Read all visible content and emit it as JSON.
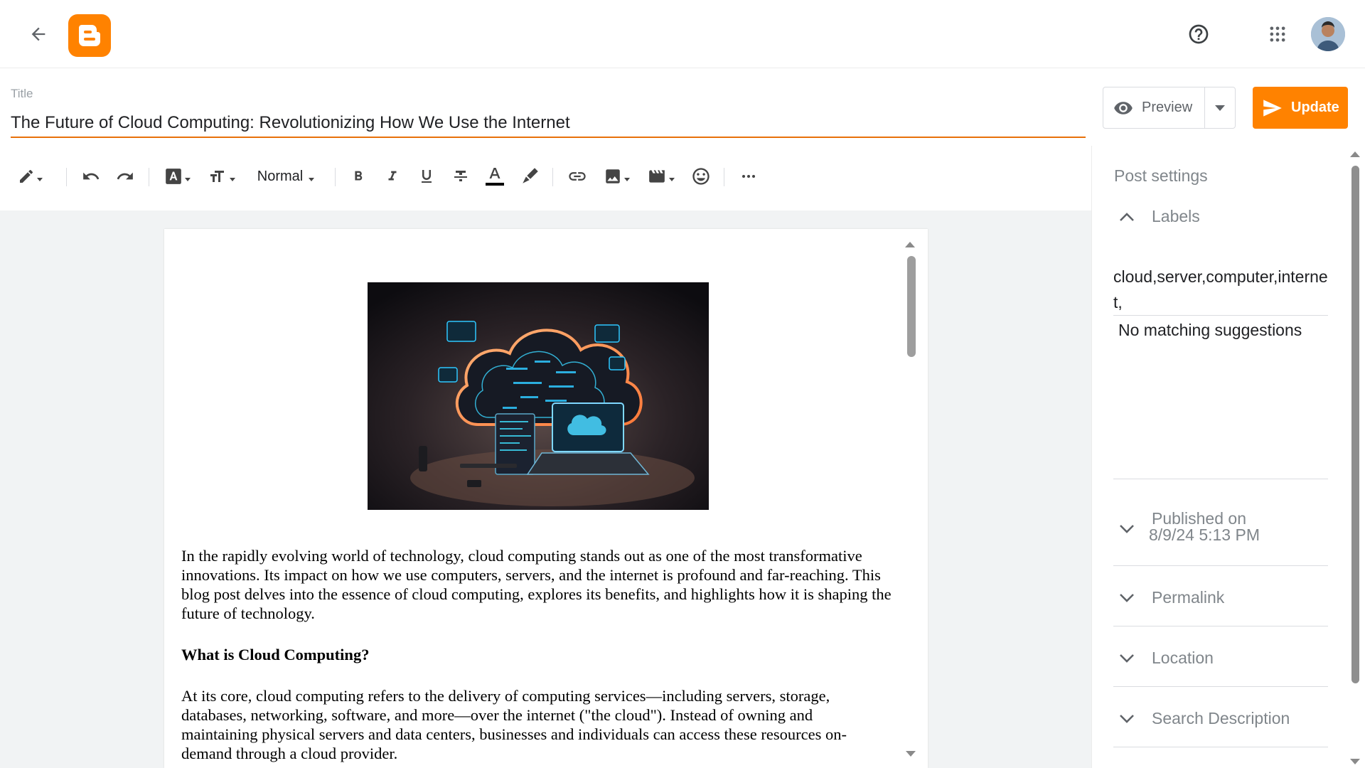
{
  "title_field": {
    "label": "Title",
    "value": "The Future of Cloud Computing: Revolutionizing How We Use the Internet"
  },
  "actions": {
    "preview_label": "Preview",
    "update_label": "Update"
  },
  "toolbar": {
    "paragraph_style": "Normal",
    "icons": [
      "pencil-icon",
      "undo-icon",
      "redo-icon",
      "font-icon",
      "text-size-icon",
      "bold-icon",
      "italic-icon",
      "underline-icon",
      "strikethrough-icon",
      "text-color-icon",
      "highlight-icon",
      "link-icon",
      "image-icon",
      "video-icon",
      "emoji-icon",
      "more-icon"
    ]
  },
  "document": {
    "paragraph1": "In the rapidly evolving world of technology, cloud computing stands out as one of the most transformative innovations. Its impact on how we use computers, servers, and the internet is profound and far-reaching. This blog post delves into the essence of cloud computing, explores its benefits, and highlights how it is shaping the future of technology.",
    "heading1": "What is Cloud Computing?",
    "paragraph2": "At its core, cloud computing refers to the delivery of computing services—including servers, storage, databases, networking, software, and more—over the internet (\"the cloud\"). Instead of owning and maintaining physical servers and data centers, businesses and individuals can access these resources on-demand through a cloud provider."
  },
  "post_settings": {
    "title": "Post settings",
    "labels": {
      "heading": "Labels",
      "value": "cloud,server,computer,internet,",
      "suggestion": "No matching suggestions"
    },
    "published": {
      "heading": "Published on",
      "date": "8/9/24 5:13 PM"
    },
    "permalink": "Permalink",
    "location": "Location",
    "search_description": "Search Description"
  },
  "colors": {
    "brand": "#ff8200",
    "accent_underline": "#e8710a",
    "muted_text": "#80868b"
  }
}
